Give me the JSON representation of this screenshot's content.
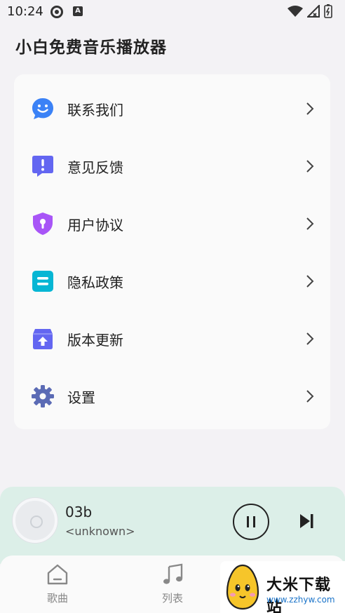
{
  "status": {
    "time": "10:24",
    "badge_letter": "A"
  },
  "app": {
    "title": "小白免费音乐播放器"
  },
  "menu": {
    "items": [
      {
        "label": "联系我们",
        "icon": "smile-chat-icon",
        "color": "#3b82f6"
      },
      {
        "label": "意见反馈",
        "icon": "feedback-icon",
        "color": "#6366f1"
      },
      {
        "label": "用户协议",
        "icon": "shield-lock-icon",
        "color": "#a855f7"
      },
      {
        "label": "隐私政策",
        "icon": "privacy-doc-icon",
        "color": "#06b6d4"
      },
      {
        "label": "版本更新",
        "icon": "update-box-icon",
        "color": "#6366f1"
      },
      {
        "label": "设置",
        "icon": "gear-icon",
        "color": "#5b6bb5"
      }
    ]
  },
  "player": {
    "title": "03b",
    "artist": "<unknown>",
    "state": "playing",
    "accent": "#dcefe8"
  },
  "tabs": [
    {
      "label": "歌曲",
      "icon": "home-icon"
    },
    {
      "label": "列表",
      "icon": "music-note-icon"
    }
  ],
  "watermark": {
    "title": "大米下载站",
    "url": "www.zzhyw.com"
  }
}
